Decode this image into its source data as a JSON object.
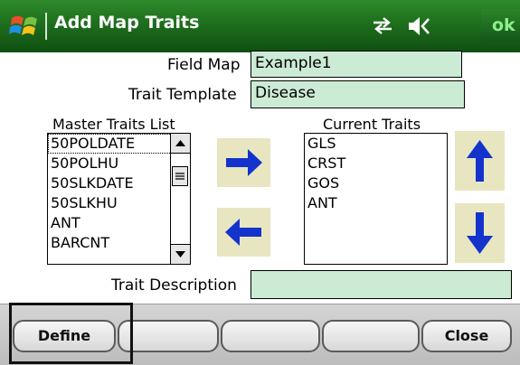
{
  "title_bar": {
    "title": "Add Map Traits",
    "ok_label": "ok",
    "icons": [
      "windows-logo-icon",
      "sync-icon",
      "speaker-icon"
    ]
  },
  "form": {
    "field_map_label": "Field Map",
    "field_map_value": "Example1",
    "trait_template_label": "Trait Template",
    "trait_template_value": "Disease",
    "trait_description_label": "Trait Description",
    "trait_description_value": ""
  },
  "master_traits": {
    "label": "Master Traits List",
    "items": [
      "50POLDATE",
      "50POLHU",
      "50SLKDATE",
      "50SLKHU",
      "ANT",
      "BARCNT"
    ],
    "selected_index": 0
  },
  "current_traits": {
    "label": "Current Traits",
    "items": [
      "GLS",
      "CRST",
      "GOS",
      "ANT"
    ]
  },
  "softkeys": {
    "define_label": "Define",
    "close_label": "Close"
  },
  "colors": {
    "titlebar": "#1d6b1c",
    "field_bg": "#ccebd4",
    "arrow_blue": "#1333cc",
    "arrow_button_bg": "#e8e6c0"
  }
}
